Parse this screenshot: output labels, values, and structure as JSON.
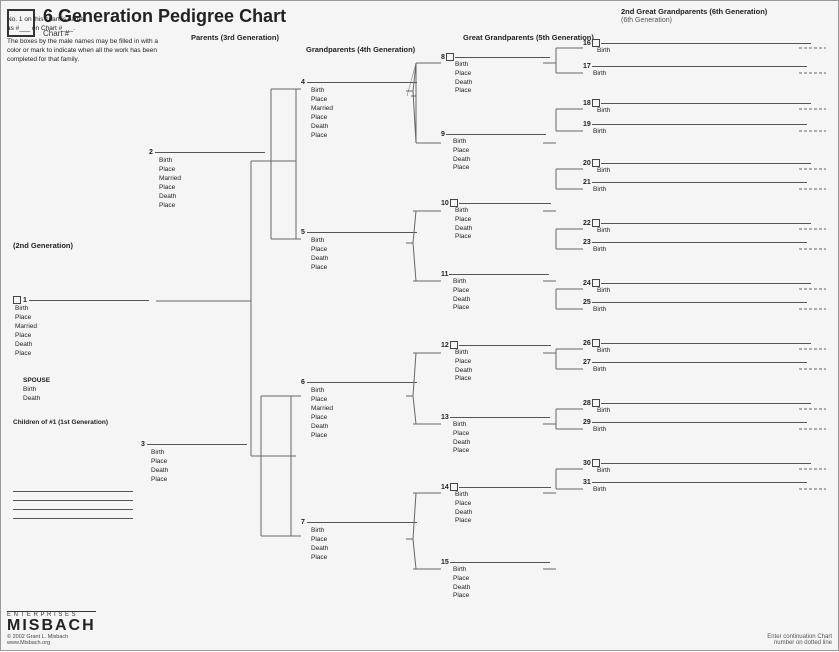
{
  "title": "6 Generation Pedigree Chart",
  "chart_num_label": "Chart #",
  "no1_text": "No. 1 on this chart is same",
  "no1_text2": "as #___ on Chart #___.",
  "boxes_text": "The boxes by the male names may be filled in with a color or mark to indicate when all the work has been completed for that family.",
  "gen_labels": {
    "gen2": "(2nd Generation)",
    "gen3": "Parents (3rd Generation)",
    "gen4": "Grandparents (4th Generation)",
    "gen5": "Great Grandparents (5th Generation)",
    "gen6": "2nd Great Grandparents (6th Generation)"
  },
  "spouse_label": "SPOUSE",
  "children_label": "Children of #1 (1st Generation)",
  "fields": {
    "birth": "Birth",
    "place": "Place",
    "married": "Married",
    "death": "Death"
  },
  "footer": {
    "copyright": "© 2002 Grant L. Misbach",
    "website": "www.Misbach.org",
    "enterprise": "E N T E R P R I S E S",
    "misbach": "MISBACH",
    "continuation": "Enter continuation Chart",
    "continuation2": "number on dotted line"
  },
  "numbers": {
    "p1": "1",
    "p2": "2",
    "p3": "3",
    "p4": "4",
    "p5": "5",
    "p6": "6",
    "p7": "7",
    "p8": "8",
    "p9": "9",
    "p10": "10",
    "p11": "11",
    "p12": "12",
    "p13": "13",
    "p14": "14",
    "p15": "15",
    "p16": "16",
    "p17": "17",
    "p18": "18",
    "p19": "19",
    "p20": "20",
    "p21": "21",
    "p22": "22",
    "p23": "23",
    "p24": "24",
    "p25": "25",
    "p26": "26",
    "p27": "27",
    "p28": "28",
    "p29": "29",
    "p30": "30",
    "p31": "31"
  }
}
